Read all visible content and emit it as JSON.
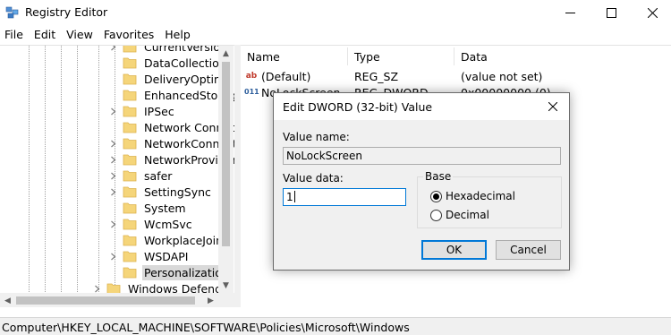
{
  "window": {
    "title": "Registry Editor"
  },
  "menu": [
    "File",
    "Edit",
    "View",
    "Favorites",
    "Help"
  ],
  "tree": {
    "items": [
      {
        "label": "CurrentVersion",
        "expandable": true,
        "selected": false
      },
      {
        "label": "DataCollection",
        "expandable": false,
        "selected": false
      },
      {
        "label": "DeliveryOptimiza",
        "expandable": false,
        "selected": false
      },
      {
        "label": "EnhancedStorag",
        "expandable": false,
        "selected": false
      },
      {
        "label": "IPSec",
        "expandable": true,
        "selected": false
      },
      {
        "label": "Network Connec",
        "expandable": false,
        "selected": false
      },
      {
        "label": "NetworkConnect",
        "expandable": true,
        "selected": false
      },
      {
        "label": "NetworkProvider",
        "expandable": true,
        "selected": false
      },
      {
        "label": "safer",
        "expandable": true,
        "selected": false
      },
      {
        "label": "SettingSync",
        "expandable": true,
        "selected": false
      },
      {
        "label": "System",
        "expandable": false,
        "selected": false
      },
      {
        "label": "WcmSvc",
        "expandable": true,
        "selected": false
      },
      {
        "label": "WorkplaceJoin",
        "expandable": false,
        "selected": false
      },
      {
        "label": "WSDAPI",
        "expandable": true,
        "selected": false
      },
      {
        "label": "Personalization",
        "expandable": false,
        "selected": true
      }
    ],
    "parent_item": {
      "label": "Windows Defender",
      "expandable": true
    }
  },
  "list": {
    "columns": [
      "Name",
      "Type",
      "Data"
    ],
    "rows": [
      {
        "icon": "string-value-icon",
        "name": "(Default)",
        "type": "REG_SZ",
        "data": "(value not set)"
      },
      {
        "icon": "dword-value-icon",
        "name": "NoLockScreen",
        "type": "REG_DWORD",
        "data": "0x00000000 (0)"
      }
    ]
  },
  "status": {
    "path": "Computer\\HKEY_LOCAL_MACHINE\\SOFTWARE\\Policies\\Microsoft\\Windows"
  },
  "dialog": {
    "title": "Edit DWORD (32-bit) Value",
    "value_name_label": "Value name:",
    "value_name": "NoLockScreen",
    "value_data_label": "Value data:",
    "value_data": "1",
    "base_label": "Base",
    "radio_hex": "Hexadecimal",
    "radio_dec": "Decimal",
    "selected_base": "Hexadecimal",
    "ok": "OK",
    "cancel": "Cancel"
  },
  "colors": {
    "accent": "#0078d7",
    "folder": "#f5d57a",
    "folder_dark": "#dcb24f",
    "selection": "#d9d9d9"
  }
}
